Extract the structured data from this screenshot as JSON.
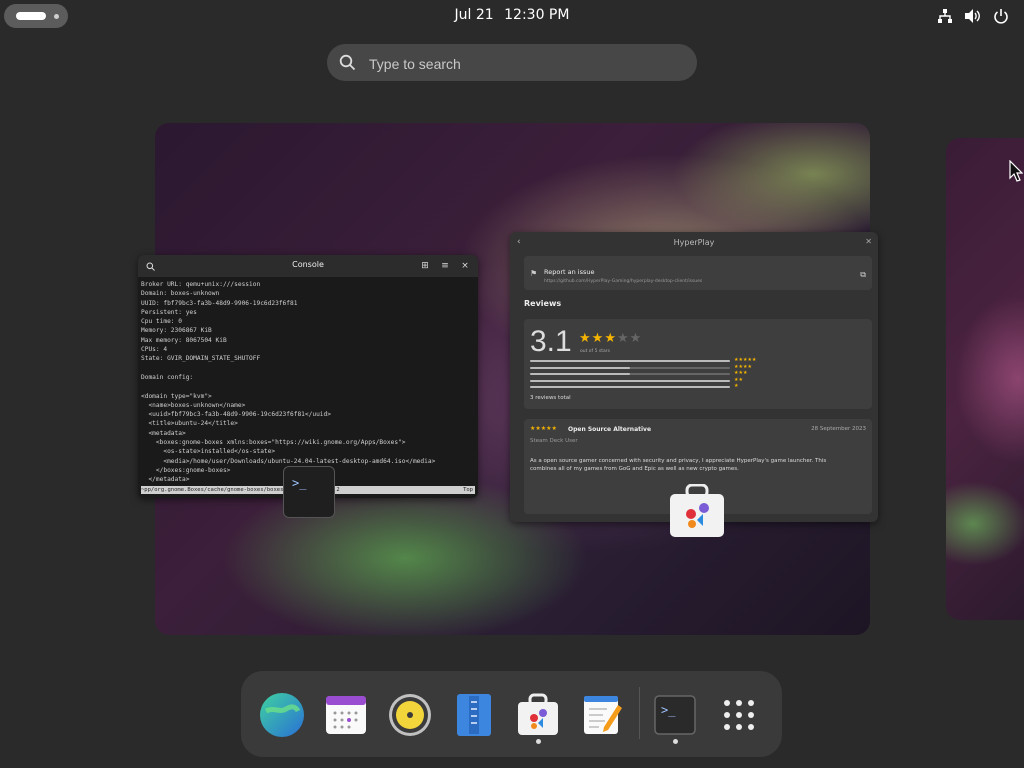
{
  "topbar": {
    "date": "Jul 21",
    "time": "12:30 PM",
    "status_icons": [
      "network-icon",
      "volume-icon",
      "power-icon"
    ]
  },
  "search": {
    "placeholder": "Type to search"
  },
  "console_window": {
    "title": "Console",
    "lines": [
      "Broker URL: qemu+unix:///session",
      "Domain: boxes-unknown",
      "UUID: fbf79bc3-fa3b-48d9-9906-19c6d23f6f81",
      "Persistent: yes",
      "Cpu time: 0",
      "Memory: 2306867 KiB",
      "Max memory: 8067504 KiB",
      "CPUs: 4",
      "State: GVIR_DOMAIN_STATE_SHUTOFF",
      "",
      "Domain config:",
      "",
      "<domain type=\"kvm\">",
      "  <name>boxes-unknown</name>",
      "  <uuid>fbf79bc3-fa3b-48d9-9906-19c6d23f6f81</uuid>",
      "  <title>ubuntu-24</title>",
      "  <metadata>",
      "    <boxes:gnome-boxes xmlns:boxes=\"https://wiki.gnome.org/Apps/Boxes\">",
      "      <os-state>installed</os-state>",
      "      <media>/home/user/Downloads/ubuntu-24.04-latest-desktop-amd64.iso</media>",
      "    </boxes:gnome-boxes>",
      "  </metadata>"
    ],
    "status_line": "~pp/org.gnome.Boxes/cache/gnome-boxes/boxes-unknown.log 21,2",
    "status_right": "Top",
    "badge_prompt": ">_"
  },
  "hyperplay_window": {
    "title": "HyperPlay",
    "report": {
      "label": "Report an issue",
      "url": "https://github.com/HyperPlay-Gaming/hyperplay-desktop-client/issues"
    },
    "reviews_heading": "Reviews",
    "rating": {
      "score": "3.1",
      "stars_filled": 3,
      "stars_total": 5,
      "out_of": "out of 5 stars",
      "distribution": [
        {
          "stars": "★★★★★",
          "fraction": 1.0
        },
        {
          "stars": "★★★★",
          "fraction": 0.5
        },
        {
          "stars": "★★★",
          "fraction": 0.5
        },
        {
          "stars": "★★",
          "fraction": 1.0
        },
        {
          "stars": "★",
          "fraction": 1.0
        }
      ],
      "total": "3 reviews total"
    },
    "review": {
      "stars": "★★★★★",
      "title": "Open Source Alternative",
      "date": "28 September 2023",
      "author": "Steam Deck User",
      "text": "As a open source gamer concerned with security and privacy, I appreciate HyperPlay's game launcher. This combines all of my games from GoG and Epic as well as new crypto games."
    }
  },
  "dock": {
    "items": [
      {
        "name": "web-browser-icon",
        "running": false
      },
      {
        "name": "calendar-icon",
        "running": false
      },
      {
        "name": "music-player-icon",
        "running": false
      },
      {
        "name": "file-archive-icon",
        "running": false
      },
      {
        "name": "software-store-icon",
        "running": true
      },
      {
        "name": "text-editor-icon",
        "running": false
      },
      {
        "name": "terminal-icon",
        "running": true
      },
      {
        "name": "app-grid-icon",
        "running": false
      }
    ]
  },
  "colors": {
    "accent_star": "#f5b400",
    "terminal_prompt": "#9fc4ff"
  }
}
